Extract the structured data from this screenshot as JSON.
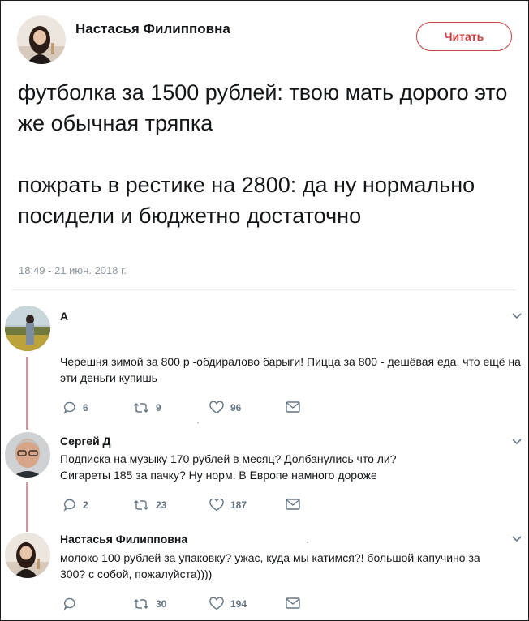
{
  "main_tweet": {
    "author_name": "Настасья Филипповна",
    "follow_label": "Читать",
    "text_paragraph_1": "футболка за 1500 рублей: твою мать дорого это же обычная тряпка",
    "text_paragraph_2": "пожрать в рестике на 2800: да ну нормально посидели и бюджетно достаточно",
    "timestamp": "18:49 - 21 июн. 2018 г."
  },
  "replies": [
    {
      "author_name": "А",
      "text": "Черешня зимой за 800 р -обдиралово барыги! Пицца за 800 - дешёвая еда, что ещё на эти деньги купишь",
      "reply_count": "6",
      "retweet_count": "9",
      "like_count": "96"
    },
    {
      "author_name": "Сергей Д",
      "text_line_1": "Подписка на музыку 170 рублей в месяц? Долбанулись что ли?",
      "text_line_2": "Сигареты 185 за пачку? Ну норм. В Европе намного дороже",
      "reply_count": "2",
      "retweet_count": "23",
      "like_count": "187"
    },
    {
      "author_name": "Настасья Филипповна",
      "text": "молоко 100 рублей за упаковку? ужас, куда мы катимся?! большой капучино за 300? с собой, пожалуйста))))",
      "reply_count": "",
      "retweet_count": "30",
      "like_count": "194"
    }
  ],
  "colors": {
    "accent": "#c8403f",
    "text": "#14171a",
    "muted": "#8b959e",
    "action": "#657786",
    "thread_line": "#c79ca5",
    "divider": "#e6ecf0"
  },
  "icons": {
    "reply": "reply-icon",
    "retweet": "retweet-icon",
    "like": "heart-icon",
    "message": "envelope-icon",
    "menu": "chevron-down-icon"
  }
}
